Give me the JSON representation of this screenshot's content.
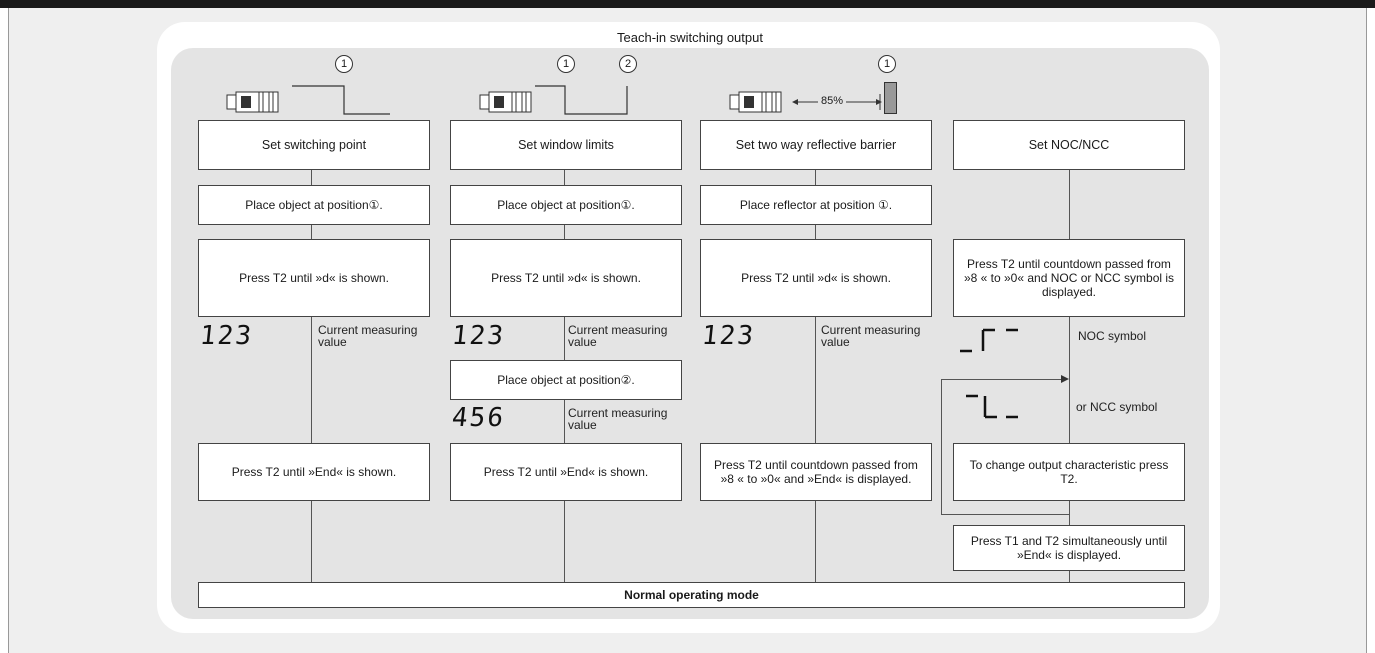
{
  "title": "Teach-in switching output",
  "columns": [
    {
      "head": "Set switching point",
      "step1": "Place object at position①.",
      "step2": "Press T2 until »d« is shown.",
      "display": {
        "digits": "123",
        "label": "Current measuring value"
      },
      "step3": "Press T2 until »End« is shown.",
      "markers": [
        "1"
      ]
    },
    {
      "head": "Set window limits",
      "step1": "Place object at position①.",
      "step2": "Press T2 until »d« is shown.",
      "display": {
        "digits": "123",
        "label": "Current measuring value"
      },
      "step_mid": "Place object at position②.",
      "display2": {
        "digits": "456",
        "label": "Current measuring value"
      },
      "step3": "Press T2 until »End« is shown.",
      "markers": [
        "1",
        "2"
      ]
    },
    {
      "head": "Set two way reflective barrier",
      "step1": "Place reflector at position ①.",
      "step2": "Press T2 until »d« is shown.",
      "display": {
        "digits": "123",
        "label": "Current measuring value"
      },
      "step3": "Press T2 until countdown passed from »8 « to »0« and »End« is displayed.",
      "markers": [
        "1"
      ],
      "distance": "85%"
    },
    {
      "head": "Set NOC/NCC",
      "step2": "Press T2 until countdown passed from »8 « to »0« and NOC or NCC symbol is displayed.",
      "noc": {
        "label": "NOC symbol"
      },
      "ncc": {
        "label": "or NCC symbol"
      },
      "step3": "To change output characteristic press T2.",
      "step4": "Press T1 and T2 simultaneously until »End« is displayed."
    }
  ],
  "footer": "Normal operating mode"
}
